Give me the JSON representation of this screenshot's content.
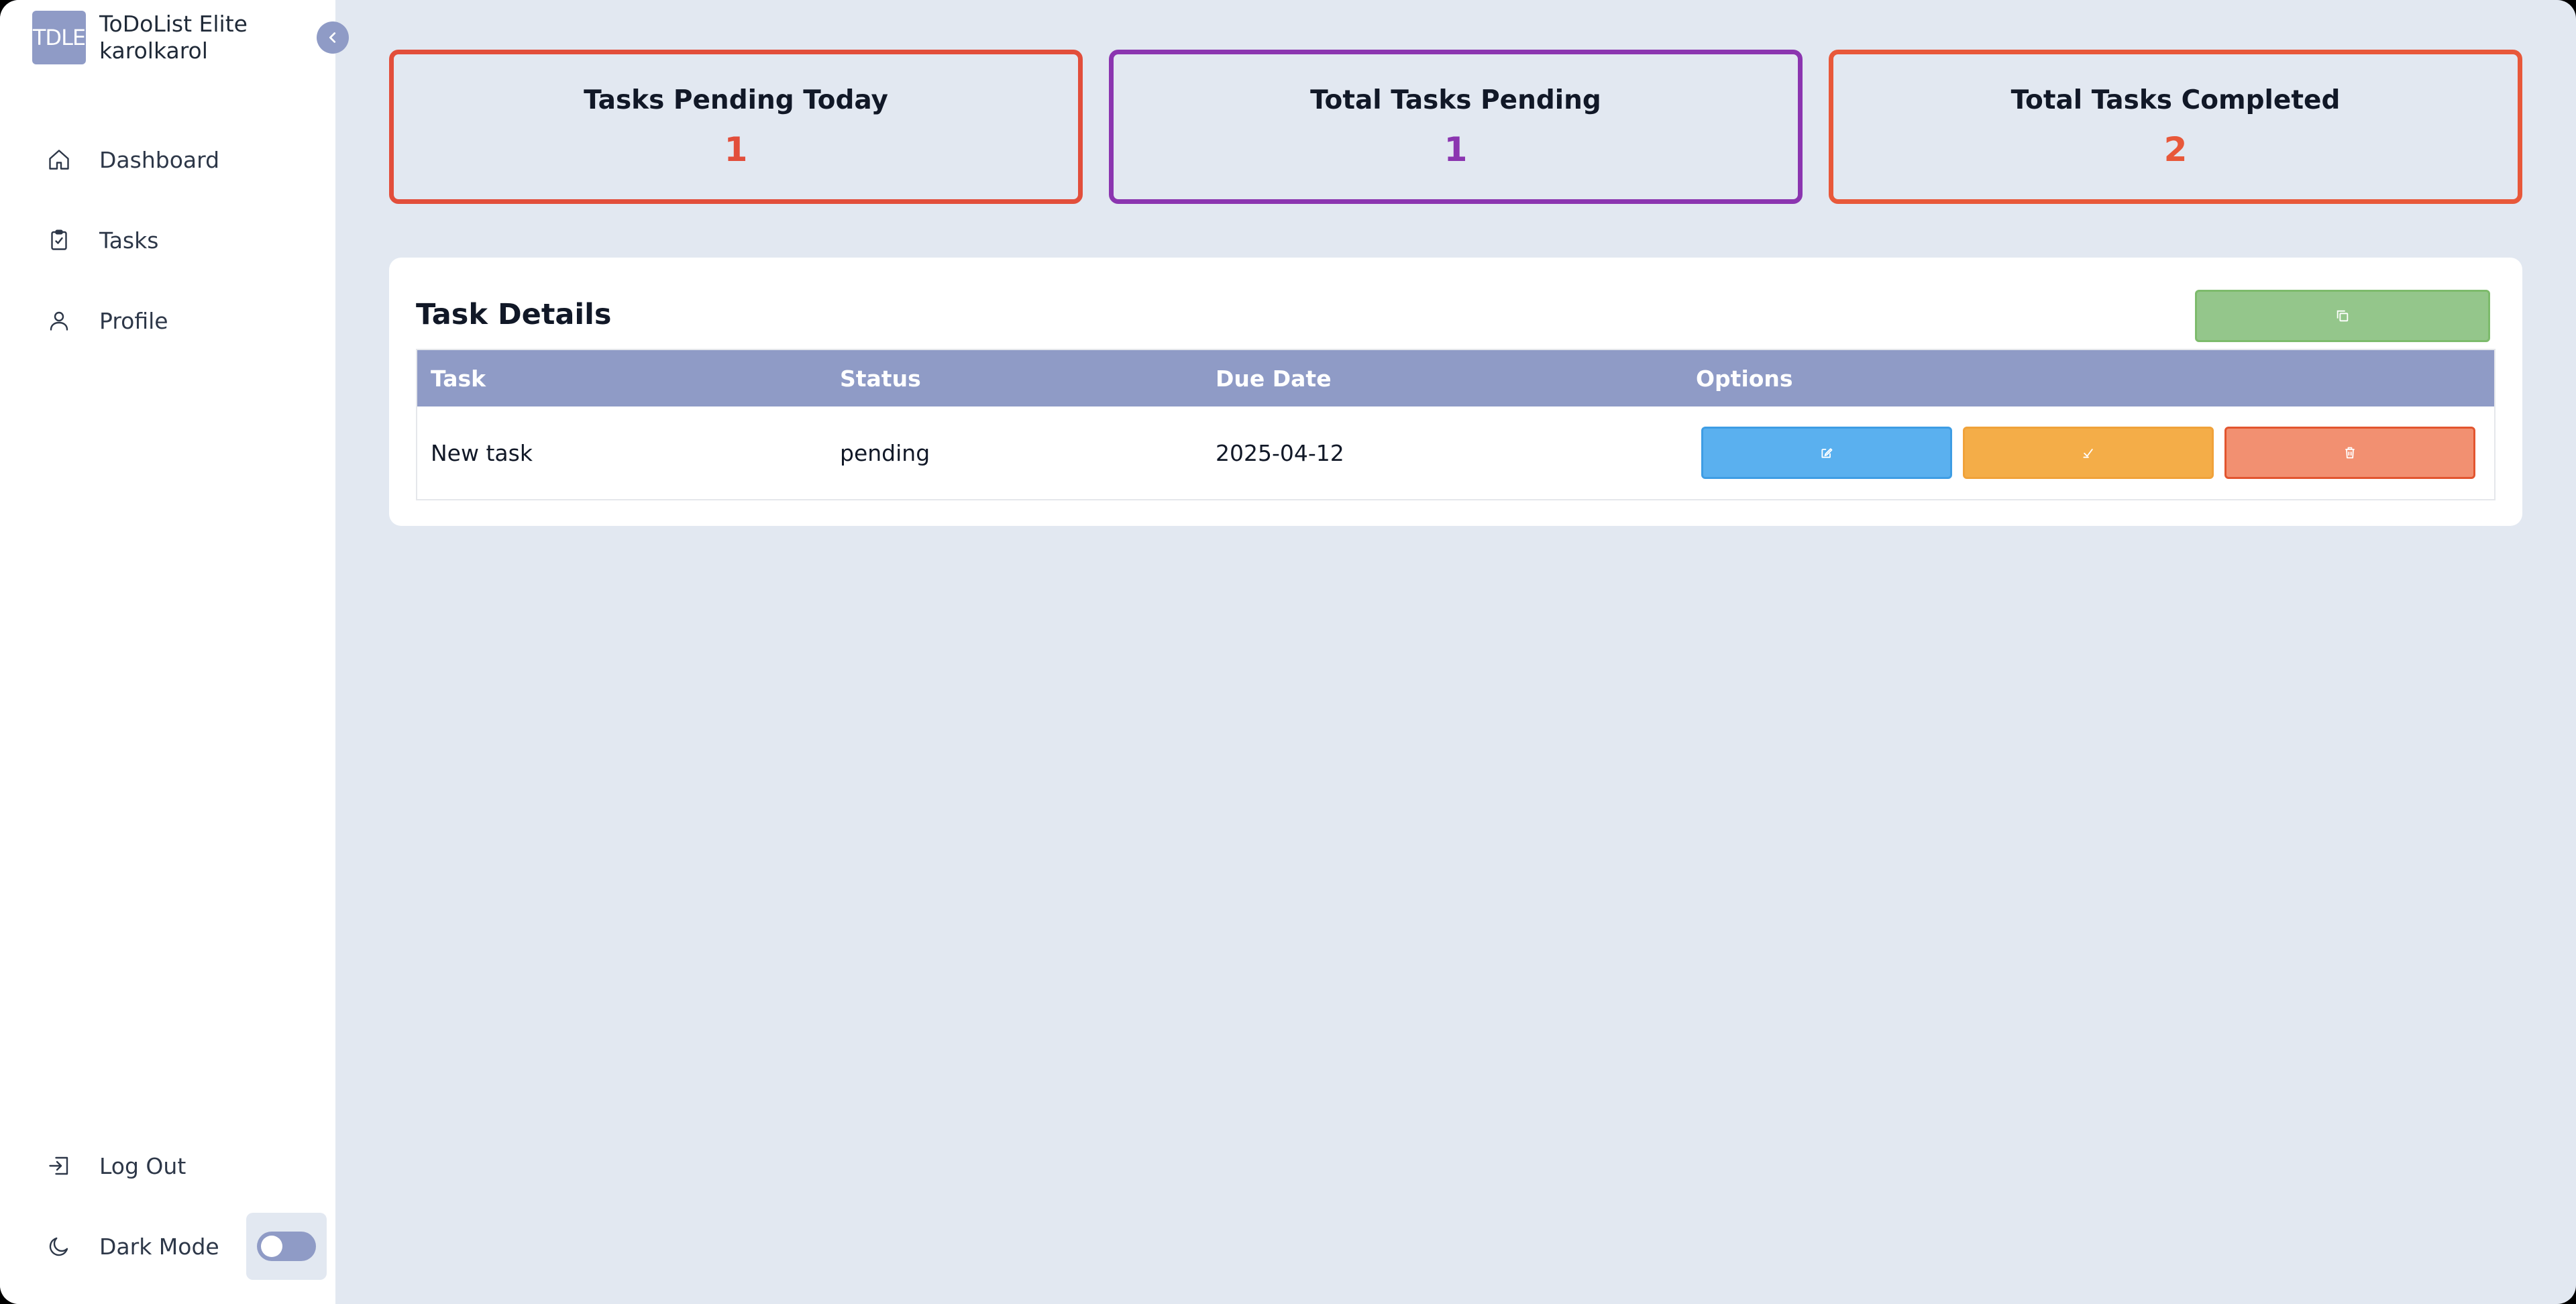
{
  "app": {
    "logo_text": "TDLE",
    "title": "ToDoList Elite",
    "username": "karolkarol"
  },
  "sidebar": {
    "items": [
      {
        "label": "Dashboard",
        "icon": "home-icon"
      },
      {
        "label": "Tasks",
        "icon": "clipboard-check-icon"
      },
      {
        "label": "Profile",
        "icon": "user-icon"
      }
    ],
    "logout_label": "Log Out",
    "dark_mode_label": "Dark Mode",
    "dark_mode_on": false
  },
  "stats": [
    {
      "title": "Tasks Pending Today",
      "value": "1",
      "color": "#e24e3b"
    },
    {
      "title": "Total Tasks Pending",
      "value": "1",
      "color": "#8b35b0"
    },
    {
      "title": "Total Tasks Completed",
      "value": "2",
      "color": "#e8583a"
    }
  ],
  "panel": {
    "title": "Task Details",
    "columns": [
      "Task",
      "Status",
      "Due Date",
      "Options"
    ],
    "rows": [
      {
        "task": "New task",
        "status": "pending",
        "due": "2025-04-12"
      }
    ]
  },
  "colors": {
    "accent": "#8f9bc6",
    "background": "#e2e8f1",
    "add_button": "#94c68b",
    "edit_button": "#5ab0ef",
    "complete_button": "#f4ad48",
    "delete_button": "#f29071"
  }
}
